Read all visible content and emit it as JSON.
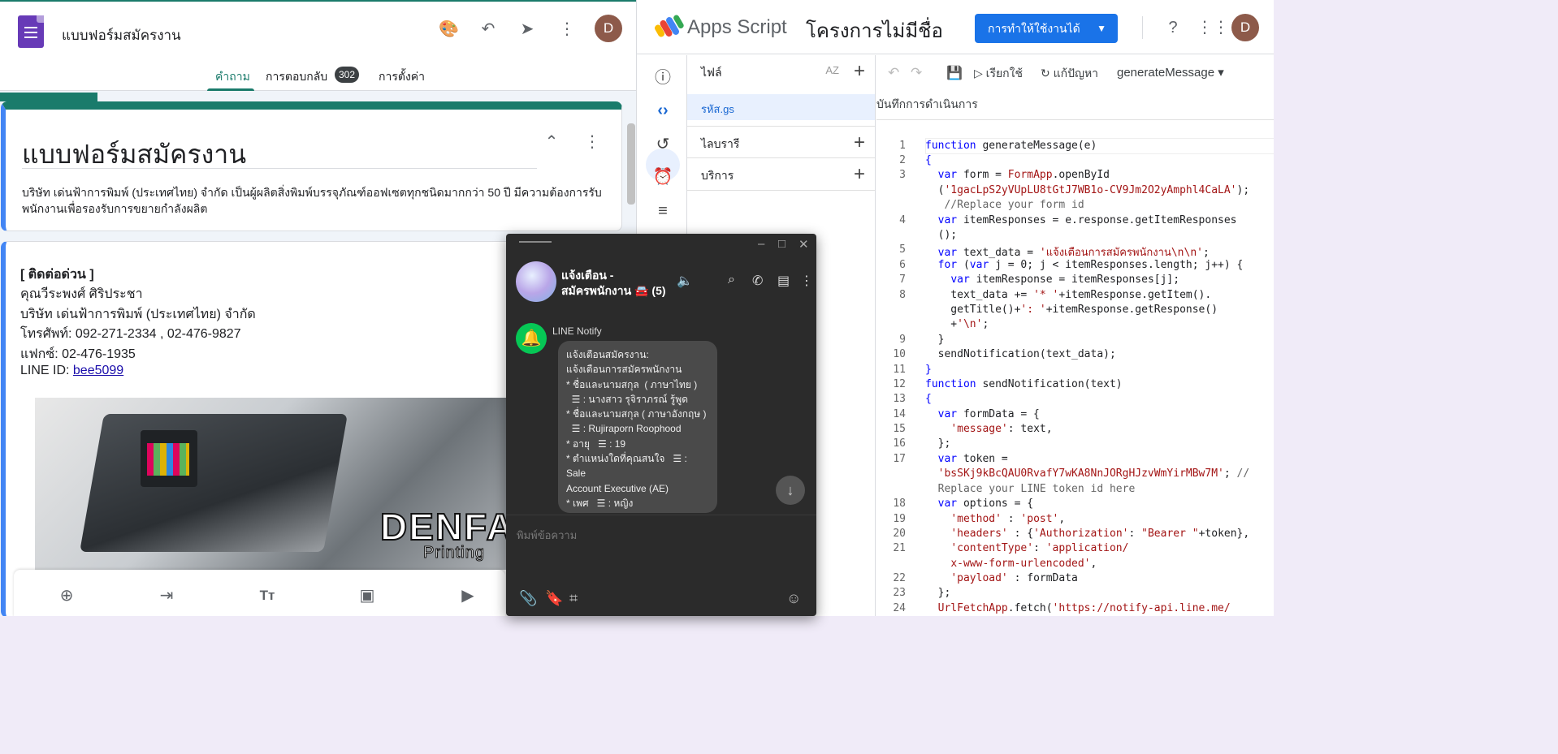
{
  "forms": {
    "title": "แบบฟอร์มสมัครงาน",
    "avatar_initial": "D",
    "tabs": [
      {
        "label": "คำถาม"
      },
      {
        "label": "การตอบกลับ"
      },
      {
        "label": "การตั้งค่า"
      }
    ],
    "responses_count": "302",
    "card_title": "แบบฟอร์มสมัครงาน",
    "card_description": "บริษัท เด่นฟ้าการพิมพ์ (ประเทศไทย) จำกัด เป็นผู้ผลิตสิ่งพิมพ์บรรจุภัณฑ์ออฟเซตทุกชนิดมากกว่า 50 ปี มีความต้องการรับพนักงานเพื่อรองรับการขยายกำลังผลิต",
    "contact": {
      "heading": "[ ติดต่อด่วน ]",
      "person": "คุณวีระพงศ์ ศิริประชา",
      "company": "บริษัท เด่นฟ้าการพิมพ์ (ประเทศไทย) จำกัด",
      "phone": "โทรศัพท์: 092-271-2334 , 02-476-9827",
      "fax": "แฟกซ์: 02-476-1935",
      "line_prefix": "LINE ID: ",
      "line_id": "bee5099"
    },
    "banner": {
      "brand": "DENFA",
      "sub": "Printing"
    }
  },
  "apps_script": {
    "product_name": "Apps Script",
    "project_name": "โครงการไม่มีชื่อ",
    "deploy_label": "การทำให้ใช้งานได้",
    "avatar_initial": "D",
    "files_label": "ไฟล์",
    "file_name": "รหัส.gs",
    "libraries_label": "ไลบรารี",
    "services_label": "บริการ",
    "run_label": "เรียกใช้",
    "debug_label": "แก้ปัญหา",
    "function_select": "generateMessage",
    "execution_log_label": "บันทึกการดำเนินการ",
    "line_numbers": [
      "1",
      "2",
      "3",
      "",
      "4",
      "",
      "5",
      "6",
      "7",
      "8",
      "",
      "",
      "9",
      "10",
      "11",
      "12",
      "13",
      "14",
      "15",
      "16",
      "17",
      "",
      "18",
      "19",
      "20",
      "21",
      "",
      "22",
      "23",
      "24"
    ]
  },
  "line_chat": {
    "chat_name_line1": "แจ้งเตือน -",
    "chat_name_line2": "สมัครพนักงาน 🚘 (5)",
    "sender": "LINE Notify",
    "message_lines": [
      "แจ้งเตือนสมัครงาน:",
      "แจ้งเตือนการสมัครพนักงาน",
      "",
      "* ชื่อและนามสกุล  ( ภาษาไทย )",
      "  ☰ : นางสาว รุจิราภรณ์ รู้พูด",
      "* ชื่อและนามสกุล ( ภาษาอังกฤษ )",
      "  ☰ : Rujiraporn Roophood",
      "* อายุ   ☰ : 19",
      "* ตำแหน่งใดที่คุณสนใจ   ☰ : Sale",
      "Account Executive (AE)",
      "* เพศ   ☰ : หญิง"
    ],
    "input_placeholder": "พิมพ์ข้อความ"
  }
}
